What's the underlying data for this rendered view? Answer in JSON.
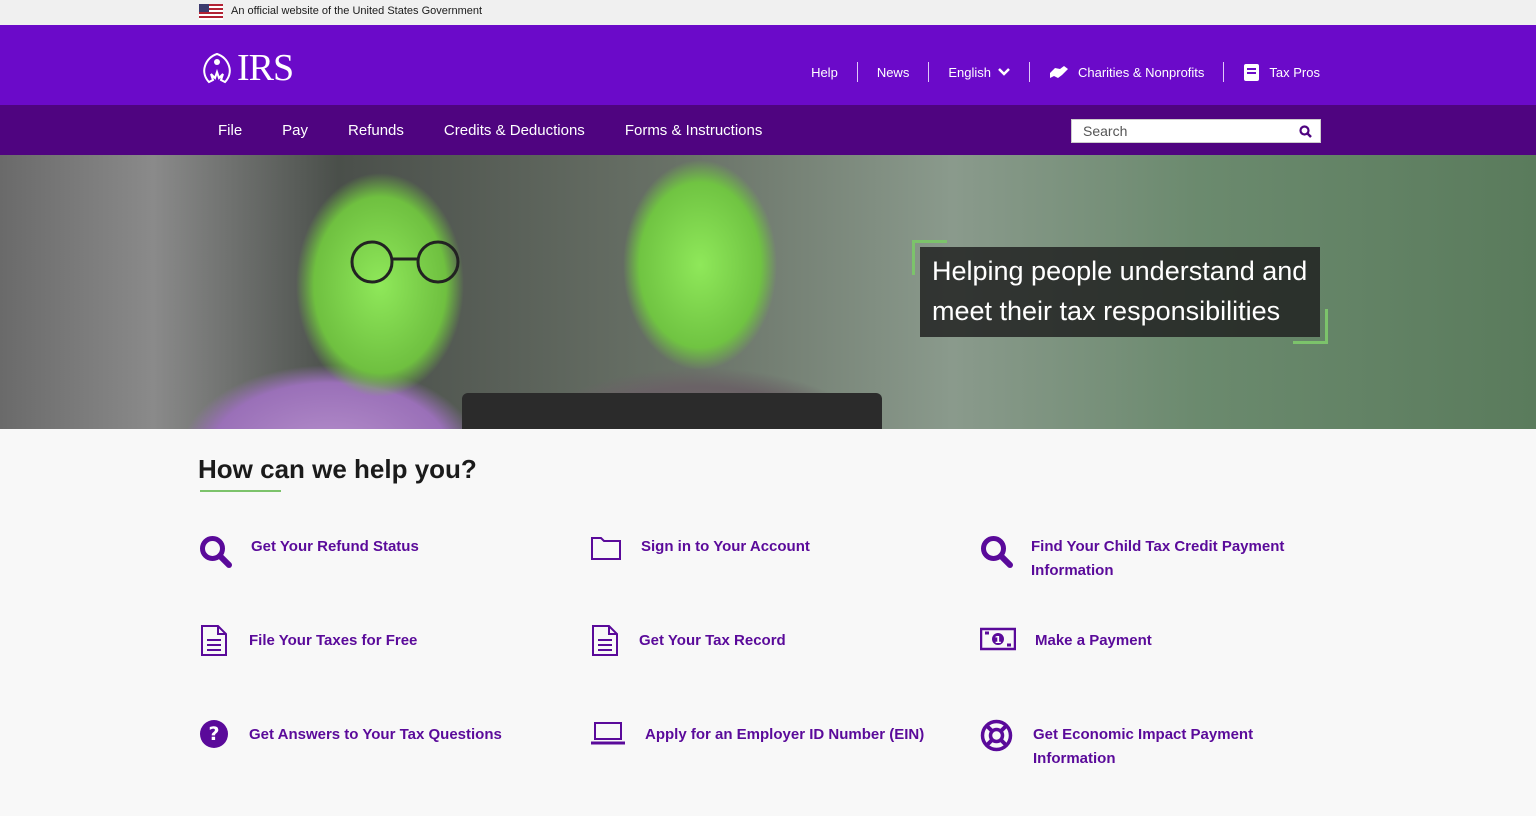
{
  "gov_banner": {
    "text": "An official website of the United States Government"
  },
  "header": {
    "logo_text": "IRS",
    "utility": [
      {
        "label": "Help"
      },
      {
        "label": "News"
      },
      {
        "label": "English"
      },
      {
        "label": "Charities & Nonprofits"
      },
      {
        "label": "Tax Pros"
      }
    ]
  },
  "nav": {
    "items": [
      "File",
      "Pay",
      "Refunds",
      "Credits & Deductions",
      "Forms & Instructions"
    ],
    "search_placeholder": "Search"
  },
  "hero": {
    "tagline_line1": "Helping people understand and",
    "tagline_line2": "meet their tax responsibilities"
  },
  "help": {
    "title": "How can we help you?",
    "tiles": [
      {
        "label": "Get Your Refund Status",
        "icon": "search-icon"
      },
      {
        "label": "Sign in to Your Account",
        "icon": "folder-icon"
      },
      {
        "label": "Find Your Child Tax Credit Payment Information",
        "icon": "search-icon"
      },
      {
        "label": "File Your Taxes for Free",
        "icon": "document-icon"
      },
      {
        "label": "Get Your Tax Record",
        "icon": "document-icon"
      },
      {
        "label": "Make a Payment",
        "icon": "money-icon"
      },
      {
        "label": "Get Answers to Your Tax Questions",
        "icon": "question-icon"
      },
      {
        "label": "Apply for an Employer ID Number (EIN)",
        "icon": "laptop-icon"
      },
      {
        "label": "Get Economic Impact Payment Information",
        "icon": "lifebuoy-icon"
      }
    ]
  },
  "colors": {
    "header": "#6b0ac9",
    "nav": "#4f0480",
    "link": "#5a0a9a",
    "accent": "#7cc36b"
  }
}
